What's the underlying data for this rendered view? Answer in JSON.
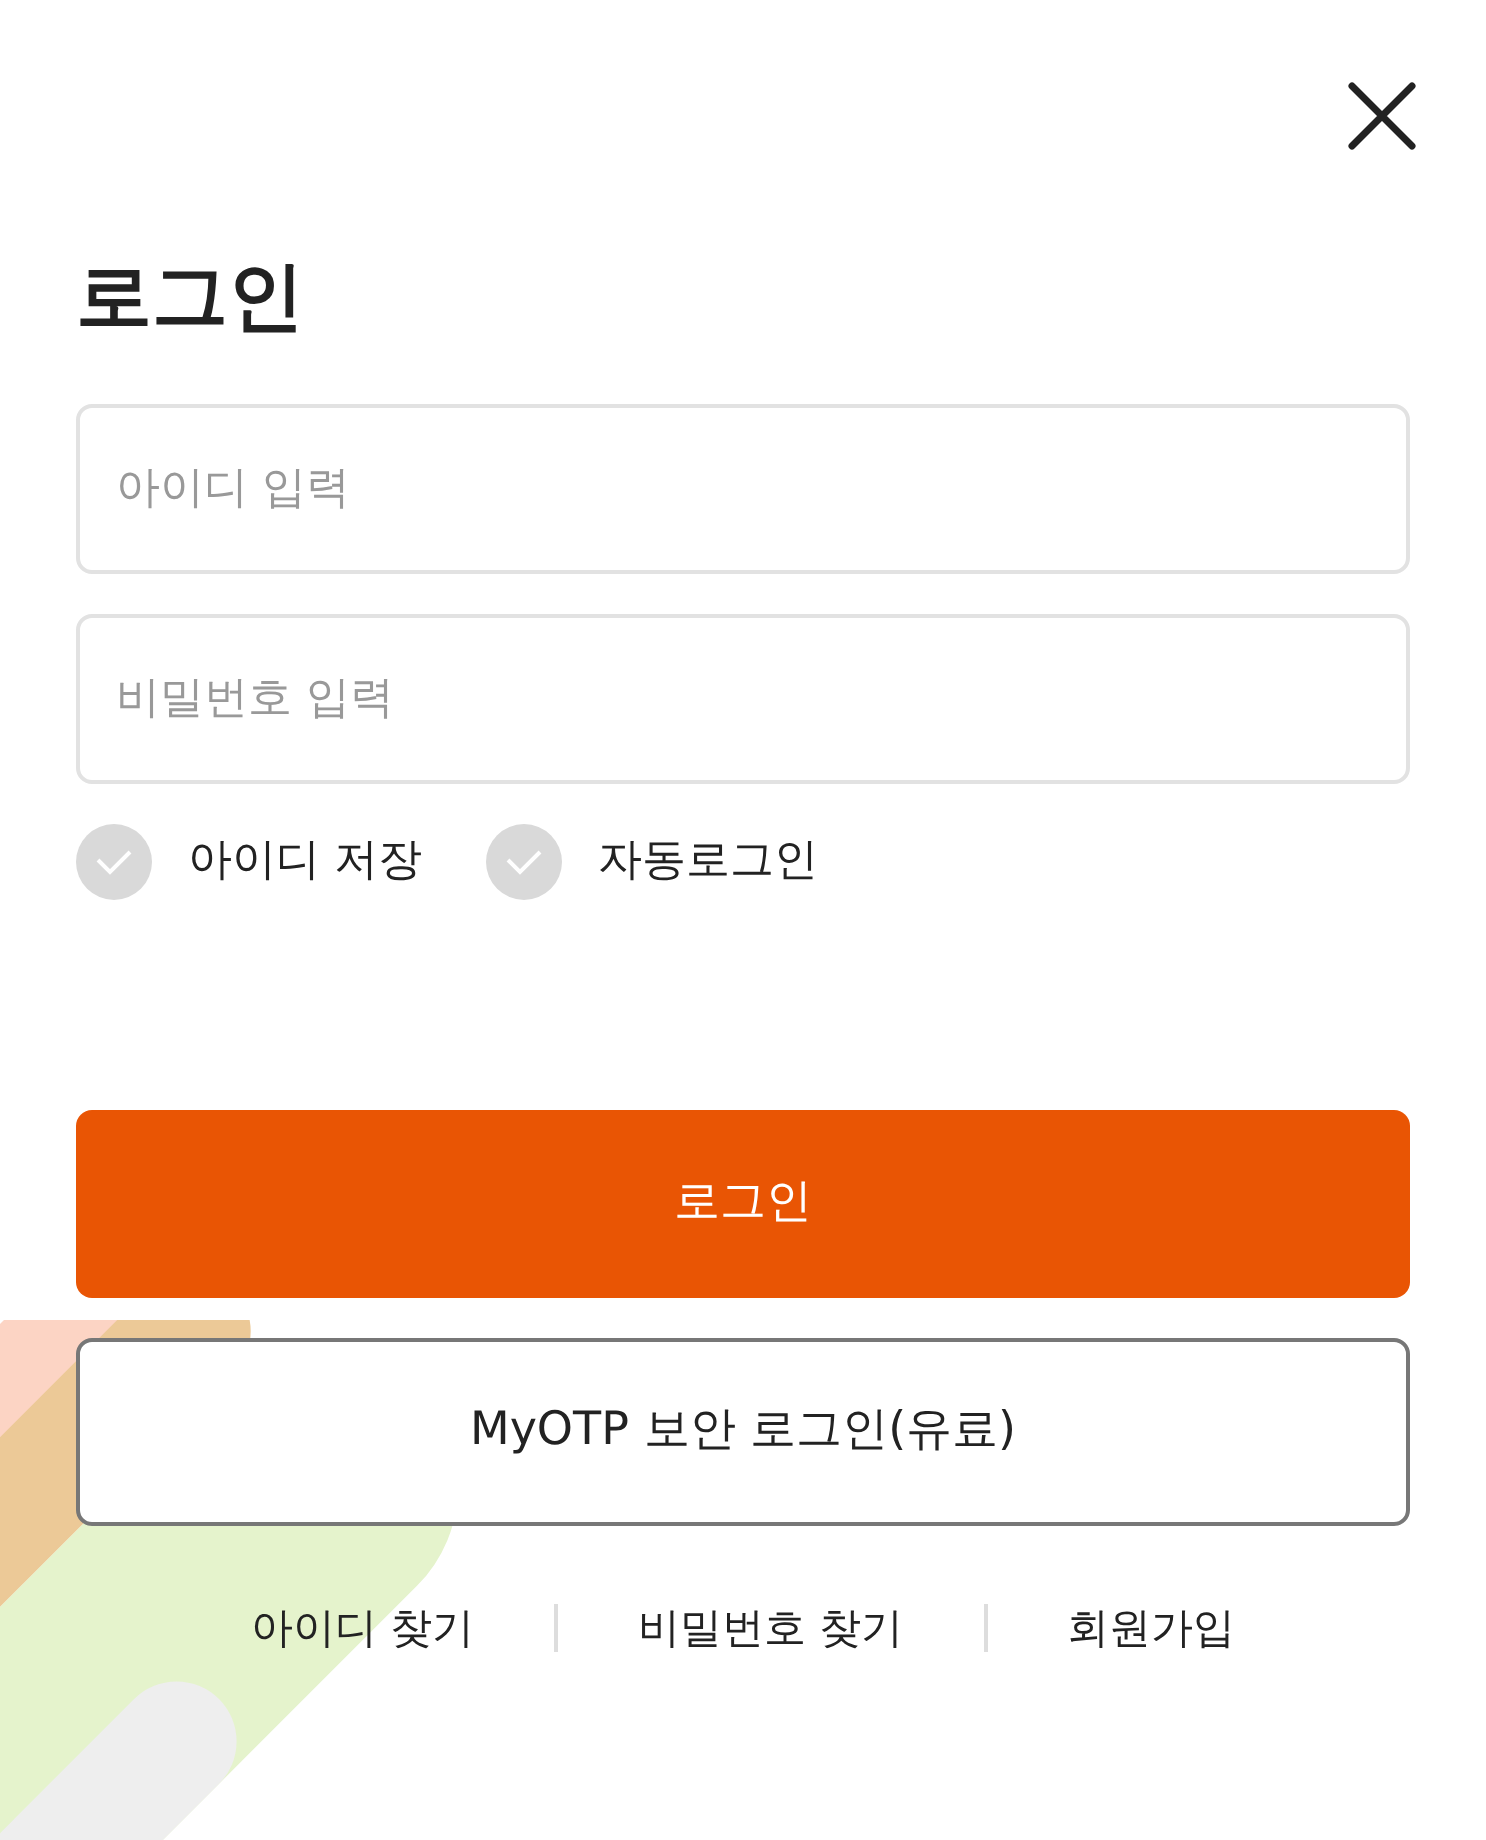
{
  "title": "로그인",
  "fields": [
    {
      "placeholder": "아이디 입력"
    },
    {
      "placeholder": "비밀번호 입력"
    }
  ],
  "options": [
    {
      "label": "아이디 저장",
      "checked": false
    },
    {
      "label": "자동로그인",
      "checked": false
    }
  ],
  "buttons": [
    {
      "label": "로그인",
      "kind": "primary"
    },
    {
      "label": "MyOTP 보안 로그인(유료)",
      "kind": "outline"
    }
  ],
  "links": [
    "아이디 찾기",
    "비밀번호 찾기",
    "회원가입"
  ]
}
